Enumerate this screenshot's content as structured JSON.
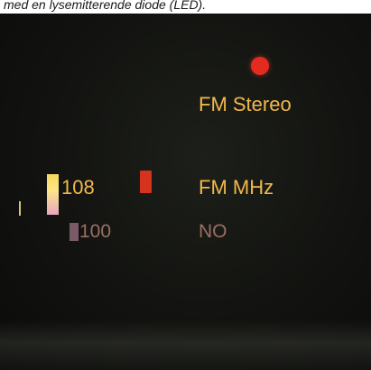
{
  "caption": "med en lysemitterende diode (LED).",
  "display": {
    "stereo_label": "FM Stereo",
    "freq_high": "108",
    "freq_low": "100",
    "band_label": "FM MHz",
    "aux_label": "NO"
  },
  "colors": {
    "background": "#121310",
    "label_bright": "#f2b94a",
    "label_dim": "#9a6f63",
    "led_red": "#e32b1f"
  }
}
